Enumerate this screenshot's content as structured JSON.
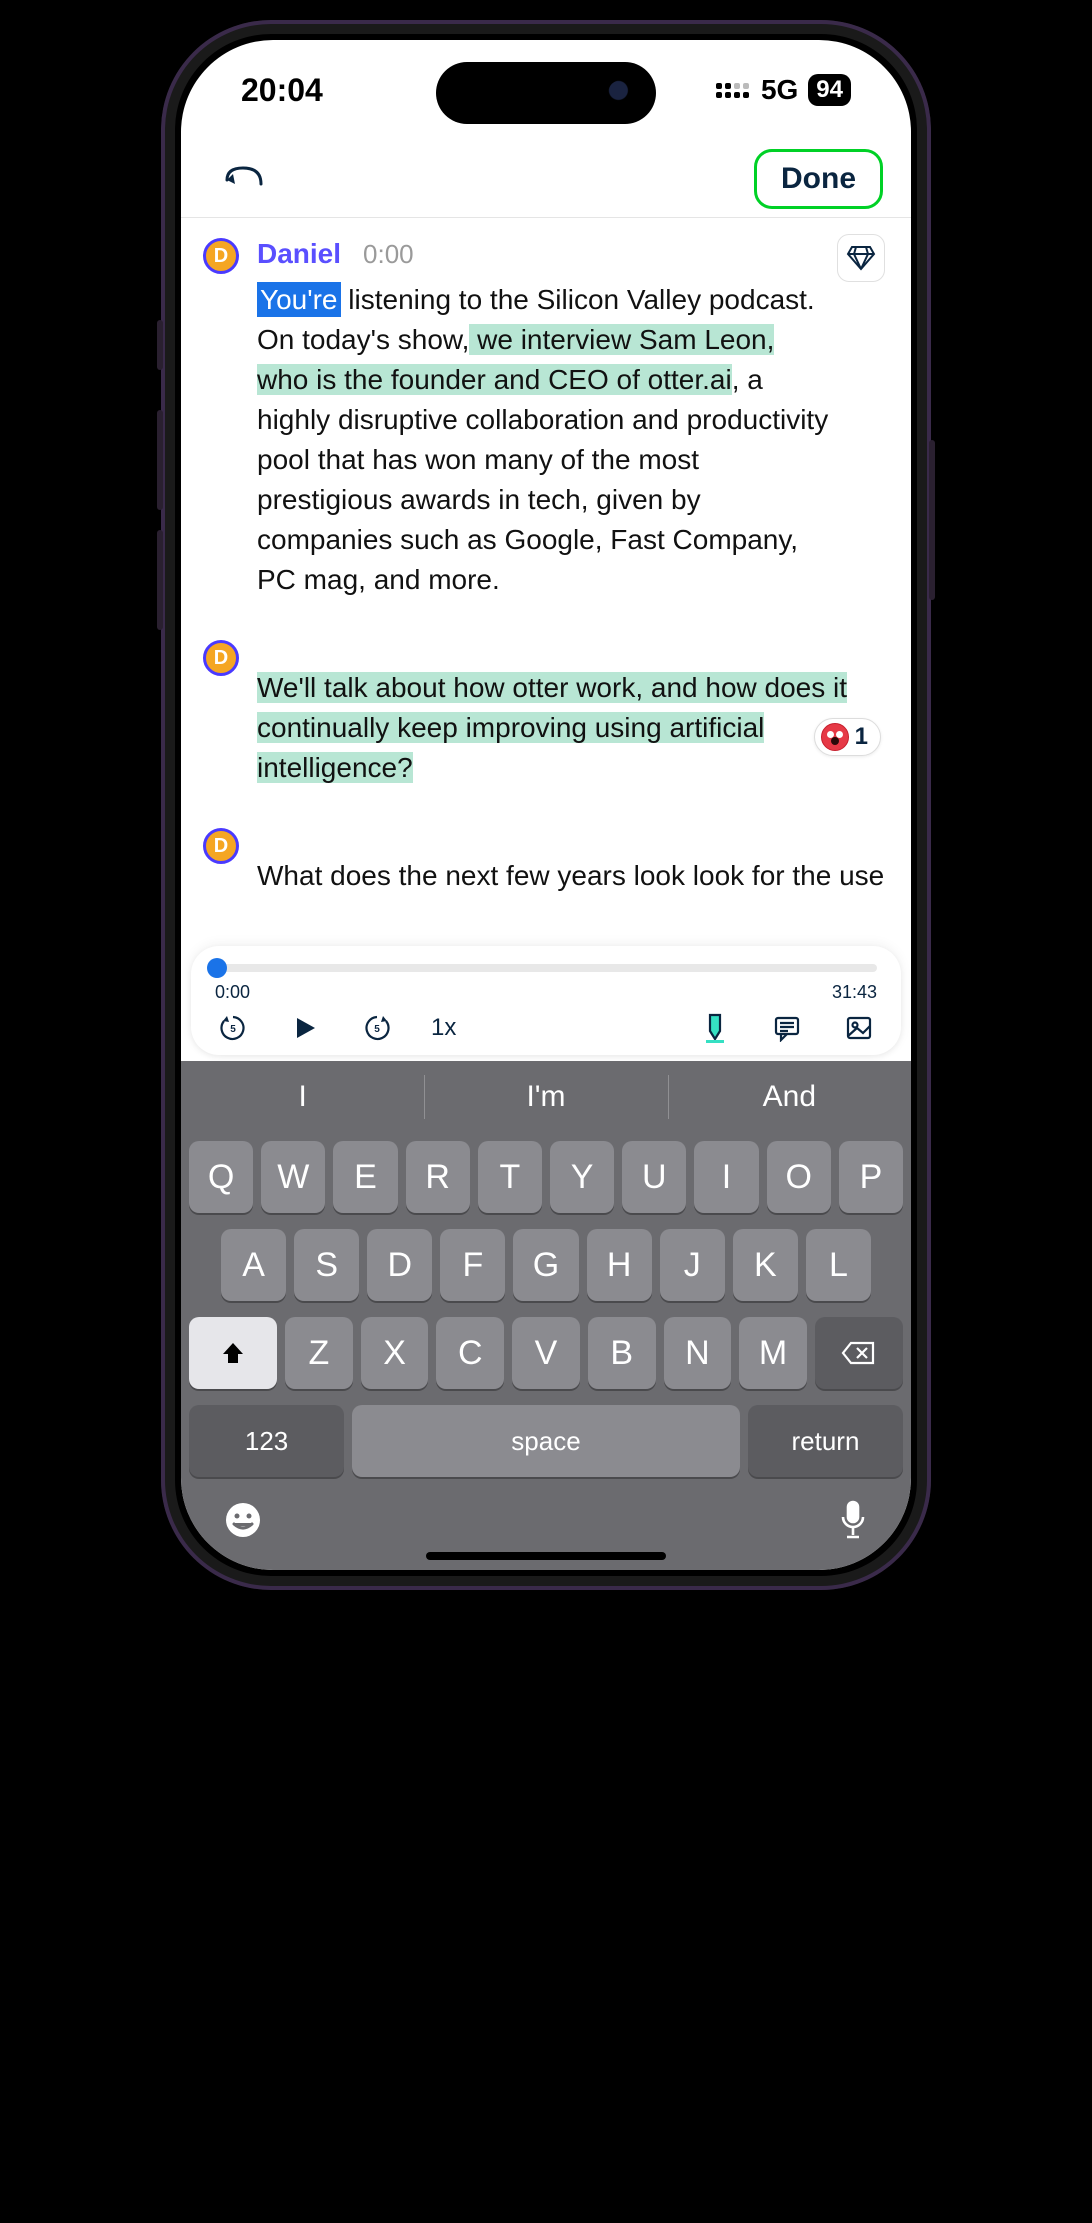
{
  "status_bar": {
    "time": "20:04",
    "network": "5G",
    "battery": "94"
  },
  "nav": {
    "done_label": "Done"
  },
  "gem_icon": "diamond",
  "transcript": {
    "block1": {
      "avatar_letter": "D",
      "speaker": "Daniel",
      "timestamp": "0:00",
      "selected_word": "You're",
      "text1": " listening to the Silicon Valley podcast. On today's show,",
      "highlight1": " we interview Sam Leon, who is the founder and CEO of otter.ai",
      "text2": ", a highly disruptive collaboration and productivity pool that has won many of the most prestigious awards in tech, given by companies such as Google, Fast Company, PC mag, and more."
    },
    "block2": {
      "avatar_letter": "D",
      "highlight": "We'll talk about how otter work, and how does it continually keep improving using artificial intelligence?"
    },
    "block3": {
      "avatar_letter": "D",
      "text": "What does the next few years look look for the use"
    }
  },
  "reaction": {
    "count": "1"
  },
  "player": {
    "current_time": "0:00",
    "total_time": "31:43",
    "speed": "1x"
  },
  "keyboard": {
    "suggestions": [
      "I",
      "I'm",
      "And"
    ],
    "row1": [
      "Q",
      "W",
      "E",
      "R",
      "T",
      "Y",
      "U",
      "I",
      "O",
      "P"
    ],
    "row2": [
      "A",
      "S",
      "D",
      "F",
      "G",
      "H",
      "J",
      "K",
      "L"
    ],
    "row3": [
      "Z",
      "X",
      "C",
      "V",
      "B",
      "N",
      "M"
    ],
    "numbers_key": "123",
    "space_label": "space",
    "return_label": "return"
  }
}
